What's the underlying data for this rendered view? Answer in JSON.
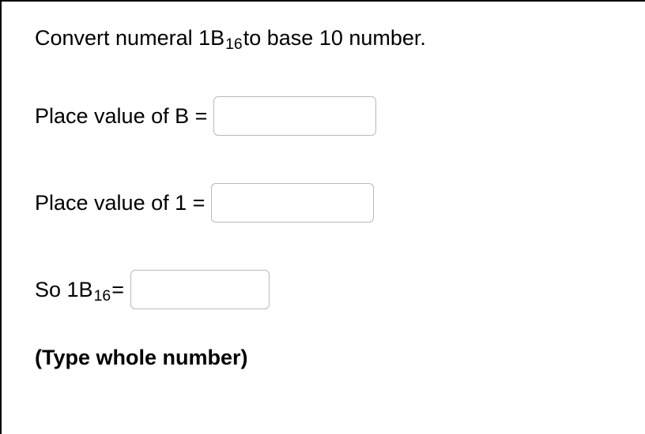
{
  "question": {
    "pre": "Convert numeral 1B",
    "sub": "16",
    "post": " to base 10 number."
  },
  "rows": {
    "b": {
      "label": "Place value of B = ",
      "value": ""
    },
    "one": {
      "label": "Place value of 1 = ",
      "value": ""
    },
    "result": {
      "pre": "So 1B",
      "sub": "16",
      "post": " = ",
      "value": ""
    }
  },
  "hint": "(Type whole number)"
}
